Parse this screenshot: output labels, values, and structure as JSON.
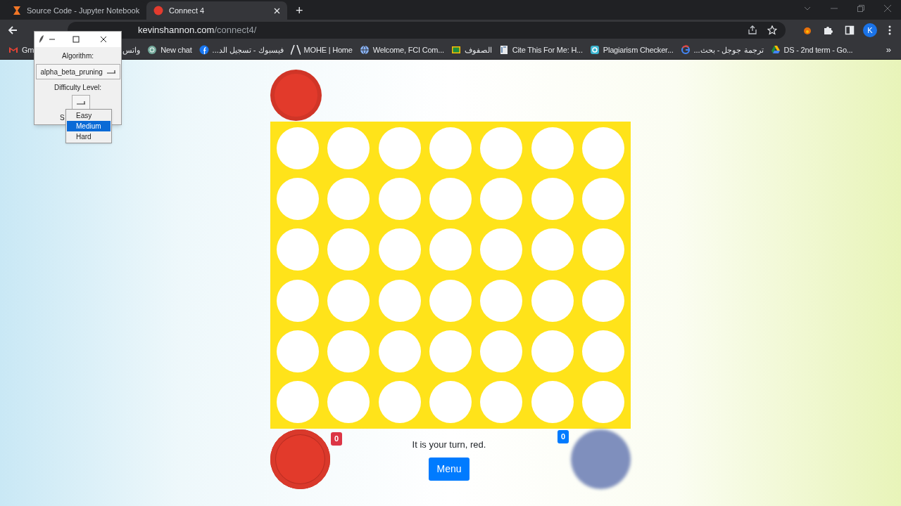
{
  "browser": {
    "tabs": [
      {
        "title": "Source Code - Jupyter Notebook",
        "kind": "jupyter",
        "selected": false
      },
      {
        "title": "Connect 4",
        "kind": "connect4",
        "selected": true
      }
    ],
    "new_tab": "+",
    "address": {
      "host": "kevinshannon.com",
      "path": "/connect4/"
    },
    "profile_initial": "K",
    "bookmarks": [
      {
        "label": "Gm",
        "kind": "gmail"
      },
      {
        "label": "واتس",
        "kind": "plain"
      },
      {
        "label": "New chat",
        "kind": "chat"
      },
      {
        "label": "فيسبوك - تسجيل الد...",
        "kind": "facebook"
      },
      {
        "label": "MOHE | Home",
        "kind": "mohe"
      },
      {
        "label": "Welcome, FCI Com...",
        "kind": "globe"
      },
      {
        "label": "الصفوف",
        "kind": "classroom"
      },
      {
        "label": "Cite This For Me: H...",
        "kind": "book"
      },
      {
        "label": "Plagiarism Checker...",
        "kind": "plagiarism"
      },
      {
        "label": "ترجمة جوجل - بحث...",
        "kind": "google"
      },
      {
        "label": "DS - 2nd term - Go...",
        "kind": "drive"
      }
    ],
    "more_bookmarks": "»"
  },
  "settings_window": {
    "algorithm_label": "Algorithm:",
    "algorithm_value": "alpha_beta_pruning",
    "difficulty_label": "Difficulty Level:",
    "hidden_button_text": "S",
    "options": [
      {
        "label": "Easy",
        "selected": false
      },
      {
        "label": "Medium",
        "selected": true
      },
      {
        "label": "Hard",
        "selected": false
      }
    ]
  },
  "game": {
    "next_piece": {
      "kind": "red"
    },
    "board": [
      [
        {
          "kind": "empty"
        },
        {
          "kind": "empty"
        },
        {
          "kind": "empty"
        },
        {
          "kind": "empty"
        },
        {
          "kind": "empty"
        },
        {
          "kind": "empty"
        },
        {
          "kind": "empty"
        }
      ],
      [
        {
          "kind": "empty"
        },
        {
          "kind": "empty"
        },
        {
          "kind": "empty"
        },
        {
          "kind": "empty"
        },
        {
          "kind": "empty"
        },
        {
          "kind": "empty"
        },
        {
          "kind": "empty"
        }
      ],
      [
        {
          "kind": "empty"
        },
        {
          "kind": "empty"
        },
        {
          "kind": "empty"
        },
        {
          "kind": "empty"
        },
        {
          "kind": "empty"
        },
        {
          "kind": "empty"
        },
        {
          "kind": "empty"
        }
      ],
      [
        {
          "kind": "empty"
        },
        {
          "kind": "empty"
        },
        {
          "kind": "empty"
        },
        {
          "kind": "empty"
        },
        {
          "kind": "empty"
        },
        {
          "kind": "empty"
        },
        {
          "kind": "empty"
        }
      ],
      [
        {
          "kind": "empty"
        },
        {
          "kind": "empty"
        },
        {
          "kind": "empty"
        },
        {
          "kind": "empty"
        },
        {
          "kind": "empty"
        },
        {
          "kind": "empty"
        },
        {
          "kind": "empty"
        }
      ],
      [
        {
          "kind": "empty"
        },
        {
          "kind": "empty"
        },
        {
          "kind": "empty"
        },
        {
          "kind": "empty"
        },
        {
          "kind": "empty"
        },
        {
          "kind": "empty"
        },
        {
          "kind": "empty"
        }
      ]
    ],
    "players": [
      {
        "kind": "red",
        "score": "0"
      },
      {
        "kind": "blue",
        "score": "0"
      }
    ],
    "status": "It is your turn, red.",
    "menu_button": "Menu"
  }
}
